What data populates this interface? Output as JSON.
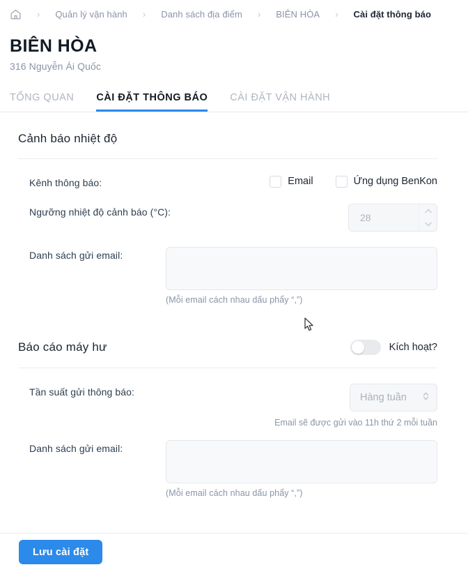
{
  "breadcrumb": {
    "home_icon": "home-icon",
    "separator": "›",
    "items": [
      {
        "label": "Quản lý vận hành",
        "current": false
      },
      {
        "label": "Danh sách địa điểm",
        "current": false
      },
      {
        "label": "BIÊN HÒA",
        "current": false
      },
      {
        "label": "Cài đặt thông báo",
        "current": true
      }
    ]
  },
  "page": {
    "title": "BIÊN HÒA",
    "subtitle": "316 Nguyễn Ái Quốc"
  },
  "tabs": [
    {
      "label": "TỔNG QUAN",
      "active": false
    },
    {
      "label": "CÀI ĐẶT THÔNG BÁO",
      "active": true
    },
    {
      "label": "CÀI ĐẶT VẬN HÀNH",
      "active": false
    }
  ],
  "temperature_section": {
    "title": "Cảnh báo nhiệt độ",
    "channel_label": "Kênh thông báo:",
    "channels": [
      {
        "label": "Email",
        "checked": false
      },
      {
        "label": "Ứng dụng BenKon",
        "checked": false
      }
    ],
    "threshold_label": "Ngưỡng nhiệt độ cảnh báo (°C):",
    "threshold_value": "28",
    "email_label": "Danh sách gửi email:",
    "email_value": "",
    "email_hint": "(Mỗi email cách nhau dấu phẩy “,”)"
  },
  "breakdown_section": {
    "title": "Báo cáo máy hư",
    "toggle_label": "Kích hoạt?",
    "toggle_on": false,
    "frequency_label": "Tần suất gửi thông báo:",
    "frequency_value": "Hàng tuần",
    "frequency_note": "Email sẽ được gửi vào 11h thứ 2 mỗi tuần",
    "email_label": "Danh sách gửi email:",
    "email_value": "",
    "email_hint": "(Mỗi email cách nhau dấu phẩy “,”)"
  },
  "footer": {
    "save_label": "Lưu cài đặt"
  },
  "colors": {
    "accent": "#2b8aea",
    "text": "#1c2430",
    "muted": "#8a94a6",
    "border": "#e4e7ec"
  }
}
